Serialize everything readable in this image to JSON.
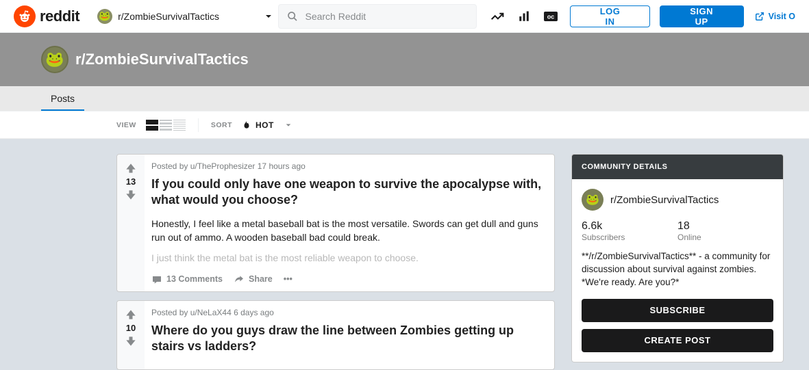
{
  "header": {
    "logo_text": "reddit",
    "subreddit_switcher": "r/ZombieSurvivalTactics",
    "search_placeholder": "Search Reddit",
    "login": "LOG IN",
    "signup": "SIGN UP",
    "visit": "Visit O"
  },
  "banner": {
    "title": "r/ZombieSurvivalTactics"
  },
  "tabs": {
    "posts": "Posts"
  },
  "sortbar": {
    "view_label": "VIEW",
    "sort_label": "SORT",
    "sort_value": "HOT"
  },
  "posts": [
    {
      "score": "13",
      "meta_prefix": "Posted by ",
      "author": "u/TheProphesizer",
      "time": " 17 hours ago",
      "title": "If you could only have one weapon to survive the apocalypse with, what would you choose?",
      "excerpt": "Honestly, I feel like a metal baseball bat is the most versatile. Swords can get dull and guns run out of ammo. A wooden baseball bad could break.",
      "excerpt_fade": "I just think the metal bat is the most reliable weapon to choose.",
      "comments": "13 Comments",
      "share": "Share",
      "more": "•••"
    },
    {
      "score": "10",
      "meta_prefix": "Posted by ",
      "author": "u/NeLaX44",
      "time": " 6 days ago",
      "title": "Where do you guys draw the line between Zombies getting up stairs vs ladders?"
    }
  ],
  "sidebar": {
    "head": "COMMUNITY DETAILS",
    "name": "r/ZombieSurvivalTactics",
    "subs_num": "6.6k",
    "subs_lbl": "Subscribers",
    "online_num": "18",
    "online_lbl": "Online",
    "desc": "**/r/ZombieSurvivalTactics** - a community for discussion about survival against zombies. *We're ready. Are you?*",
    "subscribe": "SUBSCRIBE",
    "create": "CREATE POST"
  }
}
